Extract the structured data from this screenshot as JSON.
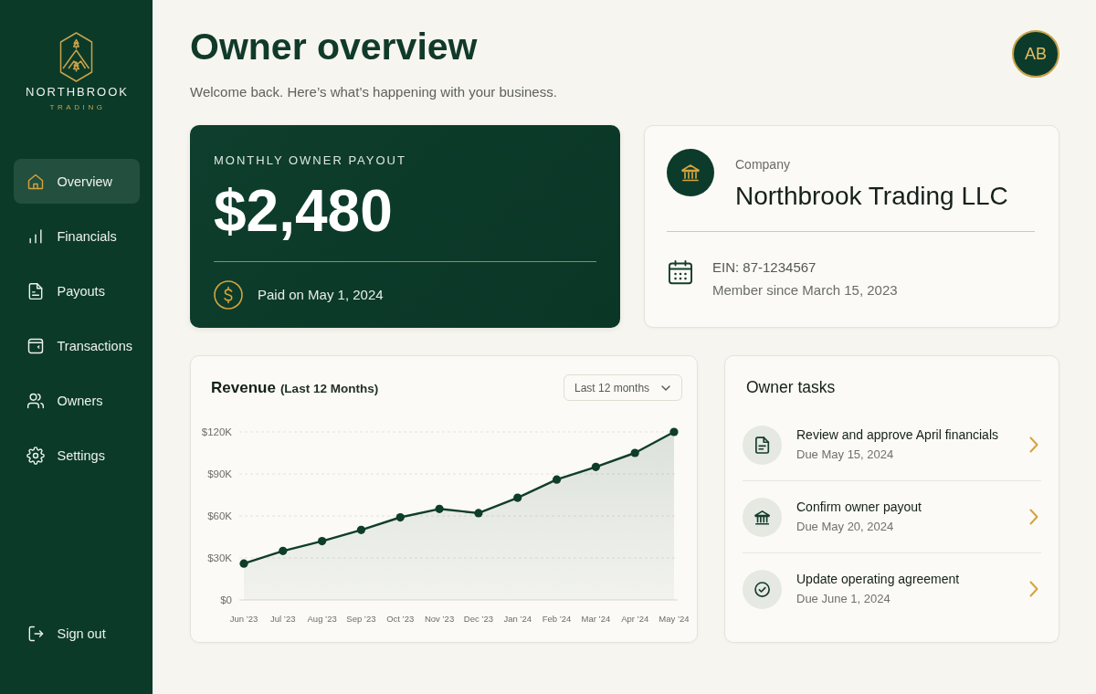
{
  "sidebar": {
    "brand": {
      "name": "NORTHBROOK",
      "tagline": "TRADING"
    },
    "items": [
      {
        "label": "Overview",
        "selected": true
      },
      {
        "label": "Financials",
        "selected": false
      },
      {
        "label": "Payouts",
        "selected": false
      },
      {
        "label": "Transactions",
        "selected": false
      },
      {
        "label": "Owners",
        "selected": false
      },
      {
        "label": "Settings",
        "selected": false
      }
    ],
    "sign_out": {
      "label": "Sign out"
    }
  },
  "header": {
    "title": "Owner overview",
    "subtitle": "Welcome back. Here’s what’s happening with your business.",
    "avatar": {
      "initials": "AB"
    }
  },
  "payout_card": {
    "label": "MONTHLY OWNER PAYOUT",
    "amount": "$2,480",
    "paid_on": "Paid on May 1, 2024"
  },
  "company_card": {
    "label": "Company",
    "name": "Northbrook Trading LLC",
    "ein": "EIN: 87-1234567",
    "member_since": "Member since March 15, 2023"
  },
  "revenue": {
    "title_note": "(Last 12 Months)",
    "range_select": {
      "value": "Last 12 months"
    },
    "chart_data": {
      "type": "area",
      "title": "Revenue",
      "categories": [
        "Jun ’23",
        "Jul ’23",
        "Aug ’23",
        "Sep ’23",
        "Oct ’23",
        "Nov ’23",
        "Dec ’23",
        "Jan ’24",
        "Feb ’24",
        "Mar ’24",
        "Apr ’24",
        "May ’24"
      ],
      "values": [
        26000,
        35000,
        42000,
        50000,
        59000,
        65000,
        62000,
        73000,
        86000,
        95000,
        105000,
        120000
      ],
      "ylim": [
        0,
        120000
      ],
      "yticks": [
        {
          "value": 0,
          "label": "$0"
        },
        {
          "value": 30000,
          "label": "$30K"
        },
        {
          "value": 60000,
          "label": "$60K"
        },
        {
          "value": 90000,
          "label": "$90K"
        },
        {
          "value": 120000,
          "label": "$120K"
        }
      ],
      "grid": true
    }
  },
  "tasks": {
    "title": "Owner tasks",
    "items": [
      {
        "title": "Review and approve April financials",
        "due": "Due May 15, 2024"
      },
      {
        "title": "Confirm owner payout",
        "due": "Due May 20, 2024"
      },
      {
        "title": "Update operating agreement",
        "due": "Due June 1, 2024"
      }
    ]
  }
}
